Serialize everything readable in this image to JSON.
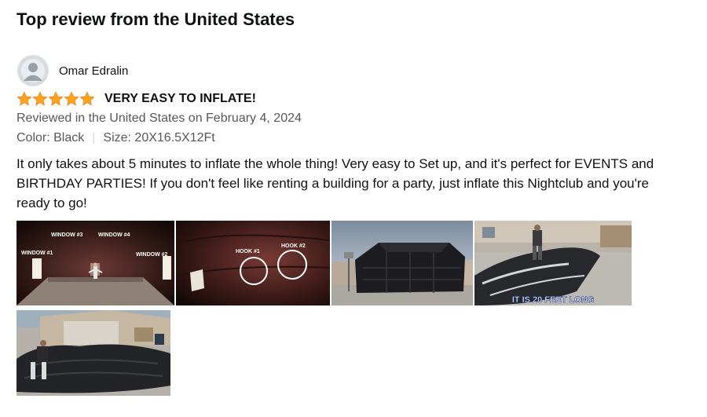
{
  "section": {
    "heading": "Top review from the United States"
  },
  "reviewer": {
    "name": "Omar Edralin",
    "avatar_icon": "default-user-icon"
  },
  "review": {
    "rating": 5,
    "rating_max": 5,
    "star_color": "#FFA41C",
    "title": "VERY EASY TO INFLATE!",
    "date_line": "Reviewed in the United States on February 4, 2024",
    "color_label": "Color: Black",
    "size_label": "Size: 20X16.5X12Ft",
    "separator": "|",
    "body": "It only takes about 5 minutes to inflate the whole thing! Very easy to Set up, and it's perfect for EVENTS and BIRTHDAY PARTIES! If you don't feel like renting a building for a party, just inflate this Nightclub and you're ready to go!"
  },
  "images": {
    "image1": {
      "labels": [
        "WINDOW #3",
        "WINDOW #4",
        "WINDOW #1",
        "WINDOW #2"
      ]
    },
    "image2": {
      "labels": [
        "HOOK #1",
        "HOOK #2"
      ]
    },
    "image4": {
      "caption": "IT IS 20 FEET LONG"
    }
  }
}
